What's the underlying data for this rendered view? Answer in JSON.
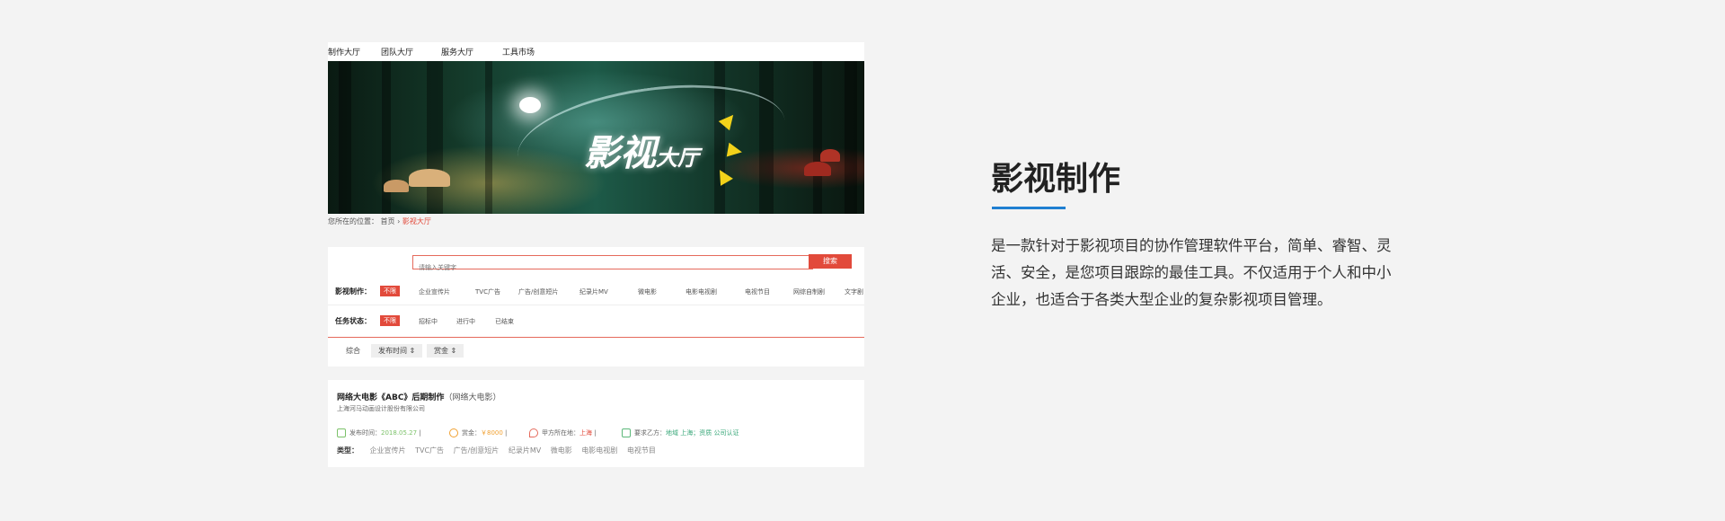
{
  "nav": {
    "items": [
      "制作大厅",
      "团队大厅",
      "服务大厅",
      "工具市场"
    ]
  },
  "banner": {
    "title_big": "影视",
    "title_small": "大厅"
  },
  "breadcrumb": {
    "prefix": "您所在的位置：",
    "home": "首页",
    "sep": "›",
    "current": "影视大厅"
  },
  "search": {
    "placeholder": "请输入关键字",
    "button": "搜索"
  },
  "filters": {
    "category_label": "影视制作：",
    "category_selected": "不限",
    "categories": [
      "企业宣传片",
      "TVC广告",
      "广告/创意短片",
      "纪录片MV",
      "微电影",
      "电影电视剧",
      "电视节目",
      "网综自制剧",
      "文字剧"
    ],
    "status_label": "任务状态：",
    "status_selected": "不限",
    "statuses": [
      "招标中",
      "进行中",
      "已结束"
    ]
  },
  "sort": {
    "overall": "综合",
    "publish_time": "发布时间 ⇕",
    "reward": "赏金 ⇕"
  },
  "task": {
    "title": "网络大电影《ABC》后期制作",
    "subtitle": "（网络大电影）",
    "company": "上海河马动画设计股份有限公司",
    "publish_label": "发布时间：",
    "publish_value": "2018.05.27",
    "reward_label": "赏金：",
    "reward_value": "￥8000",
    "location_label": "甲方所在地：",
    "location_value": "上海",
    "requirements_label": "要求乙方：",
    "requirements_value": "地域 上海；资质 公司认证",
    "types_label": "类型：",
    "types": [
      "企业宣传片",
      "TVC广告",
      "广告/创意短片",
      "纪录片MV",
      "微电影",
      "电影电视剧",
      "电视节目"
    ]
  },
  "right": {
    "heading": "影视制作",
    "description": "是一款针对于影视项目的协作管理软件平台，简单、睿智、灵活、安全，是您项目跟踪的最佳工具。不仅适用于个人和中小企业，也适合于各类大型企业的复杂影视项目管理。",
    "accent_color": "#1f7fd1"
  }
}
